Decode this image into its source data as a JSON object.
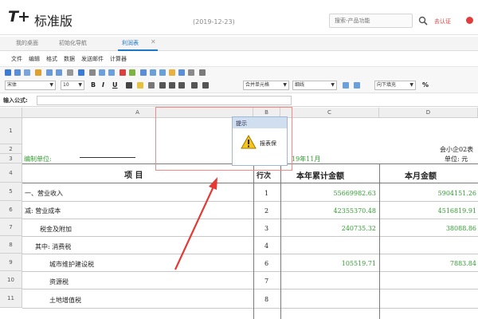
{
  "app": {
    "logo": "T+",
    "logo_sub": "标准版",
    "date": "(2019-12-23)"
  },
  "header": {
    "search_placeholder": "搜索-产品功能",
    "login_label": "去认证"
  },
  "tabs": [
    {
      "label": "我的桌面"
    },
    {
      "label": "初始化导航"
    },
    {
      "label": "利润表",
      "active": true
    }
  ],
  "menu": [
    "文件",
    "编辑",
    "格式",
    "数据",
    "发送邮件",
    "计算器"
  ],
  "toolbar": {
    "font": "宋体",
    "size": "10",
    "bold": "B",
    "italic": "I",
    "underline": "U",
    "merge": "合并单元格",
    "border": "细线",
    "fill": "向下填充",
    "percent": "%"
  },
  "formula": {
    "label": "输入公式:"
  },
  "grid": {
    "col_headers": [
      "A",
      "B",
      "C",
      "D"
    ],
    "row_headers": [
      "1",
      "2",
      "3",
      "4",
      "5",
      "6",
      "7",
      "8",
      "9",
      "10",
      "11"
    ],
    "company_label": "编制单位:",
    "period": "19年11月",
    "form_no": "会小企02表",
    "unit": "单位: 元",
    "headers": {
      "item": "项  目",
      "line": "行次",
      "ytd": "本年累计金额",
      "month": "本月金额"
    },
    "rows": [
      {
        "item": "一、营业收入",
        "line": "1",
        "ytd": "55669982.63",
        "month": "5904151.26"
      },
      {
        "item": "减: 营业成本",
        "line": "2",
        "ytd": "42355370.48",
        "month": "4516819.91"
      },
      {
        "item": "税金及附加",
        "line": "3",
        "ytd": "240735.32",
        "month": "38088.86"
      },
      {
        "item": "其中: 消费税",
        "line": "4",
        "ytd": "",
        "month": ""
      },
      {
        "item": "城市维护建设税",
        "line": "6",
        "ytd": "105519.71",
        "month": "7883.84"
      },
      {
        "item": "资源税",
        "line": "7",
        "ytd": "",
        "month": ""
      },
      {
        "item": "土地增值税",
        "line": "8",
        "ytd": "",
        "month": ""
      }
    ]
  },
  "dialog": {
    "title": "提示",
    "message": "报表保"
  },
  "colors": {
    "accent": "#1e78c8",
    "highlight": "#e23c3c",
    "number": "#2f9e2f"
  }
}
